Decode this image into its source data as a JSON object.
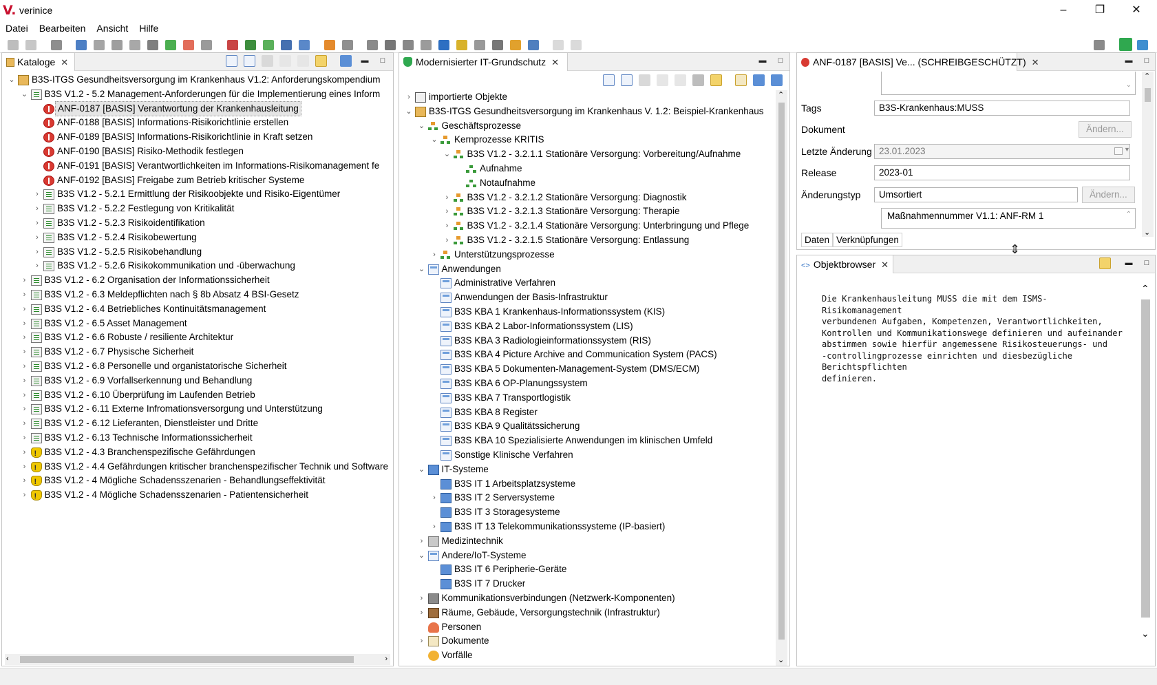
{
  "window": {
    "logo": "V.",
    "title": "verinice",
    "minimize": "–",
    "maximize": "❐",
    "close": "✕"
  },
  "menu": [
    "Datei",
    "Bearbeiten",
    "Ansicht",
    "Hilfe"
  ],
  "left_panel": {
    "tab": "Kataloge",
    "rows": [
      {
        "text": "B3S-ITGS Gesundheitsversorgung im Krankenhaus V1.2: Anforderungskompendium",
        "icon": "book-icon",
        "expanded": true,
        "level": 0
      },
      {
        "text": "B3S V1.2 - 5.2 Management-Anforderungen für die Implementierung eines Inform",
        "icon": "catalog-icon",
        "expanded": true,
        "level": 1
      },
      {
        "text": "ANF-0187 [BASIS] Verantwortung der Krankenhausleitung",
        "icon": "requirement-icon",
        "level": 2,
        "selected": true
      },
      {
        "text": "ANF-0188 [BASIS] Informations-Risikorichtlinie erstellen",
        "icon": "requirement-icon",
        "level": 2
      },
      {
        "text": "ANF-0189 [BASIS] Informations-Risikorichtlinie in Kraft setzen",
        "icon": "requirement-icon",
        "level": 2
      },
      {
        "text": "ANF-0190 [BASIS] Risiko-Methodik festlegen",
        "icon": "requirement-icon",
        "level": 2
      },
      {
        "text": "ANF-0191 [BASIS] Verantwortlichkeiten im Informations-Risikomanagement fe",
        "icon": "requirement-icon",
        "level": 2
      },
      {
        "text": "ANF-0192 [BASIS] Freigabe zum Betrieb kritischer Systeme",
        "icon": "requirement-icon",
        "level": 2
      },
      {
        "text": "B3S V1.2 - 5.2.1 Ermittlung der Risikoobjekte und Risiko-Eigentümer",
        "icon": "catalog-icon",
        "collapsed": true,
        "level": 2
      },
      {
        "text": "B3S V1.2 - 5.2.2 Festlegung von Kritikalität",
        "icon": "catalog-icon",
        "collapsed": true,
        "level": 2
      },
      {
        "text": "B3S V1.2 - 5.2.3 Risikoidentifikation",
        "icon": "catalog-icon",
        "collapsed": true,
        "level": 2
      },
      {
        "text": "B3S V1.2 - 5.2.4 Risikobewertung",
        "icon": "catalog-icon",
        "collapsed": true,
        "level": 2
      },
      {
        "text": "B3S V1.2 - 5.2.5 Risikobehandlung",
        "icon": "catalog-icon",
        "collapsed": true,
        "level": 2
      },
      {
        "text": "B3S V1.2 - 5.2.6  Risikokommunikation und -überwachung",
        "icon": "catalog-icon",
        "collapsed": true,
        "level": 2
      },
      {
        "text": "B3S V1.2 - 6.2 Organisation der Informationssicherheit",
        "icon": "catalog-icon",
        "collapsed": true,
        "level": 1
      },
      {
        "text": "B3S V1.2 - 6.3 Meldepflichten nach § 8b Absatz 4 BSI-Gesetz",
        "icon": "catalog-icon",
        "collapsed": true,
        "level": 1
      },
      {
        "text": "B3S V1.2 - 6.4 Betriebliches Kontinuitätsmanagement",
        "icon": "catalog-icon",
        "collapsed": true,
        "level": 1
      },
      {
        "text": "B3S V1.2 - 6.5 Asset Management",
        "icon": "catalog-icon",
        "collapsed": true,
        "level": 1
      },
      {
        "text": "B3S V1.2 - 6.6 Robuste / resiliente Architektur",
        "icon": "catalog-icon",
        "collapsed": true,
        "level": 1
      },
      {
        "text": "B3S V1.2 - 6.7 Physische Sicherheit",
        "icon": "catalog-icon",
        "collapsed": true,
        "level": 1
      },
      {
        "text": "B3S V1.2 - 6.8 Personelle und organistatorische Sicherheit",
        "icon": "catalog-icon",
        "collapsed": true,
        "level": 1
      },
      {
        "text": "B3S V1.2 - 6.9 Vorfallserkennung und Behandlung",
        "icon": "catalog-icon",
        "collapsed": true,
        "level": 1
      },
      {
        "text": "B3S V1.2 - 6.10 Überprüfung im Laufenden Betrieb",
        "icon": "catalog-icon",
        "collapsed": true,
        "level": 1
      },
      {
        "text": "B3S V1.2 - 6.11 Externe Infromationsversorgung und Unterstützung",
        "icon": "catalog-icon",
        "collapsed": true,
        "level": 1
      },
      {
        "text": "B3S V1.2 - 6.12 Lieferanten, Dienstleister und Dritte",
        "icon": "catalog-icon",
        "collapsed": true,
        "level": 1
      },
      {
        "text": "B3S V1.2 - 6.13 Technische Informationssicherheit",
        "icon": "catalog-icon",
        "collapsed": true,
        "level": 1
      },
      {
        "text": "B3S V1.2 - 4.3 Branchenspezifische Gefährdungen",
        "icon": "threat-icon",
        "collapsed": true,
        "level": 1
      },
      {
        "text": "B3S V1.2 - 4.4 Gefährdungen kritischer branchenspezifischer Technik und Software",
        "icon": "threat-icon",
        "collapsed": true,
        "level": 1
      },
      {
        "text": "B3S V1.2 - 4 Mögliche Schadensszenarien - Behandlungseffektivität",
        "icon": "threat-icon",
        "collapsed": true,
        "level": 1
      },
      {
        "text": "B3S V1.2 - 4 Mögliche Schadensszenarien - Patientensicherheit",
        "icon": "threat-icon",
        "collapsed": true,
        "level": 1
      }
    ]
  },
  "mid_panel": {
    "tab": "Modernisierter IT-Grundschutz",
    "rows": [
      {
        "text": "importierte Objekte",
        "icon": "import-icon",
        "collapsed": true,
        "level": 0
      },
      {
        "text": "B3S-ITGS Gesundheitsversorgung im Krankenhaus V. 1.2: Beispiel-Krankenhaus",
        "icon": "book-icon",
        "expanded": true,
        "level": 0
      },
      {
        "text": "Geschäftsprozesse",
        "icon": "org-icon",
        "expanded": true,
        "level": 1
      },
      {
        "text": "Kernprozesse KRITIS",
        "icon": "org-icon",
        "expanded": true,
        "level": 2
      },
      {
        "text": "B3S V1.2 - 3.2.1.1 Stationäre Versorgung: Vorbereitung/Aufnahme",
        "icon": "org-icon",
        "expanded": true,
        "level": 3
      },
      {
        "text": "Aufnahme",
        "icon": "process-icon",
        "level": 4
      },
      {
        "text": "Notaufnahme",
        "icon": "process-icon",
        "level": 4
      },
      {
        "text": "B3S V1.2 - 3.2.1.2 Stationäre Versorgung: Diagnostik",
        "icon": "org-icon",
        "collapsed": true,
        "level": 3
      },
      {
        "text": "B3S V1.2 - 3.2.1.3 Stationäre Versorgung: Therapie",
        "icon": "org-icon",
        "collapsed": true,
        "level": 3
      },
      {
        "text": "B3S V1.2 - 3.2.1.4 Stationäre Versorgung: Unterbringung und Pflege",
        "icon": "org-icon",
        "collapsed": true,
        "level": 3
      },
      {
        "text": "B3S V1.2 - 3.2.1.5 Stationäre Versorgung: Entlassung",
        "icon": "org-icon",
        "collapsed": true,
        "level": 3
      },
      {
        "text": "Unterstützungsprozesse",
        "icon": "org-icon",
        "collapsed": true,
        "level": 2
      },
      {
        "text": "Anwendungen",
        "icon": "app-icon",
        "expanded": true,
        "level": 1
      },
      {
        "text": "Administrative Verfahren",
        "icon": "app-icon",
        "level": 2
      },
      {
        "text": "Anwendungen der Basis-Infrastruktur",
        "icon": "app-icon",
        "level": 2
      },
      {
        "text": "B3S KBA 1 Krankenhaus-Informationssystem (KIS)",
        "icon": "app-icon",
        "level": 2
      },
      {
        "text": "B3S KBA 2 Labor-Informationssystem (LIS)",
        "icon": "app-icon",
        "level": 2
      },
      {
        "text": "B3S KBA 3 Radiologieinformationssystem (RIS)",
        "icon": "app-icon",
        "level": 2
      },
      {
        "text": "B3S KBA 4 Picture Archive and Communication System (PACS)",
        "icon": "app-icon",
        "level": 2
      },
      {
        "text": "B3S KBA 5 Dokumenten-Management-System (DMS/ECM)",
        "icon": "app-icon",
        "level": 2
      },
      {
        "text": "B3S KBA 6 OP-Planungssystem",
        "icon": "app-icon",
        "level": 2
      },
      {
        "text": "B3S KBA 7 Transportlogistik",
        "icon": "app-icon",
        "level": 2
      },
      {
        "text": "B3S KBA 8 Register",
        "icon": "app-icon",
        "level": 2
      },
      {
        "text": "B3S KBA 9 Qualitätssicherung",
        "icon": "app-icon",
        "level": 2
      },
      {
        "text": "B3S KBA 10 Spezialisierte Anwendungen im klinischen Umfeld",
        "icon": "app-icon",
        "level": 2
      },
      {
        "text": "Sonstige Klinische Verfahren",
        "icon": "app-icon",
        "level": 2
      },
      {
        "text": "IT-Systeme",
        "icon": "it-system-icon",
        "expanded": true,
        "level": 1
      },
      {
        "text": "B3S IT 1 Arbeitsplatzsysteme",
        "icon": "it-system-icon",
        "level": 2
      },
      {
        "text": "B3S IT 2 Serversysteme",
        "icon": "it-system-icon",
        "collapsed": true,
        "level": 2
      },
      {
        "text": "B3S IT 3 Storagesysteme",
        "icon": "it-system-icon",
        "level": 2
      },
      {
        "text": "B3S IT 13 Telekommunikationssysteme (IP-basiert)",
        "icon": "it-system-icon",
        "collapsed": true,
        "level": 2
      },
      {
        "text": "Medizintechnik",
        "icon": "medical-icon",
        "collapsed": true,
        "level": 1
      },
      {
        "text": "Andere/IoT-Systeme",
        "icon": "app-icon",
        "expanded": true,
        "level": 1
      },
      {
        "text": "B3S IT 6 Peripherie-Geräte",
        "icon": "it-system-icon",
        "level": 2
      },
      {
        "text": "B3S IT 7 Drucker",
        "icon": "it-system-icon",
        "level": 2
      },
      {
        "text": "Kommunikationsverbindungen (Netzwerk-Komponenten)",
        "icon": "network-icon",
        "collapsed": true,
        "level": 1
      },
      {
        "text": "Räume, Gebäude, Versorgungstechnik (Infrastruktur)",
        "icon": "room-icon",
        "collapsed": true,
        "level": 1
      },
      {
        "text": "Personen",
        "icon": "person-icon",
        "level": 1
      },
      {
        "text": "Dokumente",
        "icon": "document-icon",
        "collapsed": true,
        "level": 1
      },
      {
        "text": "Vorfälle",
        "icon": "incident-icon",
        "level": 1
      }
    ]
  },
  "editor": {
    "tab": "ANF-0187 [BASIS] Ve... (SCHREIBGESCHÜTZT)",
    "tags_label": "Tags",
    "tags_value": "B3S-Krankenhaus:MUSS",
    "dokument_label": "Dokument",
    "aendern": "Ändern...",
    "letzte_label": "Letzte Änderung",
    "letzte_value": "23.01.2023",
    "release_label": "Release",
    "release_value": "2023-01",
    "typ_label": "Änderungstyp",
    "typ_value": "Umsortiert",
    "massnahme_value": "Maßnahmennummer V1.1: ANF-RM 1",
    "subtab_daten": "Daten",
    "subtab_verkn": "Verknüpfungen"
  },
  "objektbrowser": {
    "tab": "Objektbrowser",
    "text": "Die Krankenhausleitung MUSS die mit dem ISMS-Risikomanagement\nverbundenen Aufgaben, Kompetenzen, Verantwortlichkeiten,\nKontrollen und Kommunikationswege definieren und aufeinander\nabstimmen sowie hierfür angemessene Risikosteuerungs- und\n-controllingprozesse einrichten und diesbezügliche Berichtspflichten\ndefinieren."
  },
  "colors": {
    "accent": "#d83a32",
    "selection": "#e5e5e5",
    "chrome": "#f0f0f0"
  }
}
